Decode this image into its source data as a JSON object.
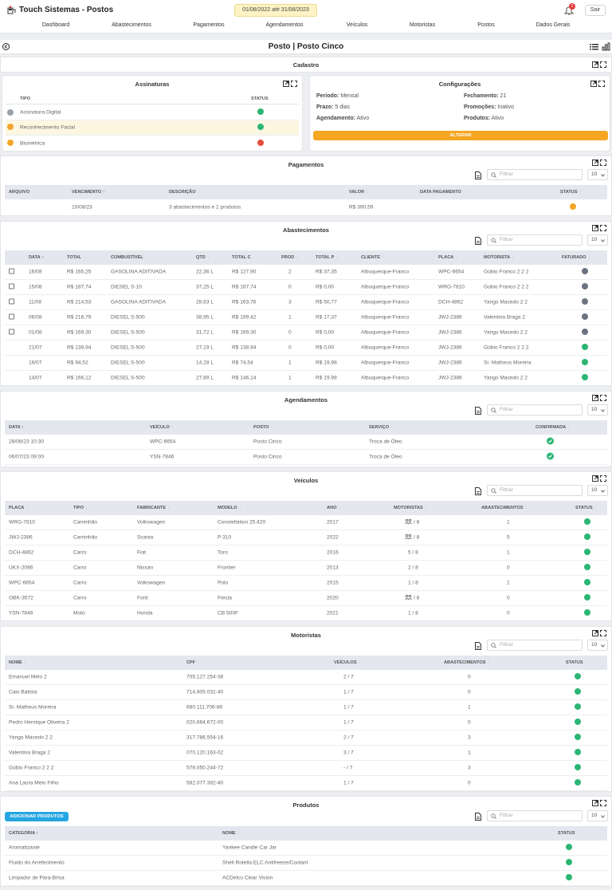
{
  "app": {
    "title": "Touch Sistemas - Postos",
    "date_range": "01/08/2022 até 31/08/2023",
    "notifications": "2",
    "logout": "Sair"
  },
  "nav": [
    "Dashboard",
    "Abastecimentos",
    "Pagamentos",
    "Agendamentos",
    "Veículos",
    "Motoristas",
    "Postos",
    "Dados Gerais"
  ],
  "page": {
    "title": "Posto | Posto Cinco"
  },
  "cadastro": {
    "title": "Cadastro"
  },
  "assinaturas": {
    "title": "Assinaturas",
    "cols": [
      "TIPO",
      "STATUS"
    ],
    "rows": [
      {
        "tipo": "Assinatura Digital",
        "status": "green",
        "icon": "gray"
      },
      {
        "tipo": "Reconhecimento Facial",
        "status": "green",
        "icon": "orange"
      },
      {
        "tipo": "Biométrica",
        "status": "red",
        "icon": "orange"
      }
    ]
  },
  "configuracoes": {
    "title": "Configurações",
    "labels": {
      "periodo": "Período:",
      "prazo": "Prazo:",
      "agendamento": "Agendamento:",
      "fechamento": "Fechamento:",
      "promocoes": "Promoções:",
      "produtos": "Produtos:"
    },
    "values": {
      "periodo": "Mensal",
      "prazo": "5 dias",
      "agendamento": "Ativo",
      "fechamento": "21",
      "promocoes": "Inativo",
      "produtos": "Ativo"
    },
    "button": "ALTERAR"
  },
  "filter": {
    "placeholder": "Filtrar",
    "page_size": "10"
  },
  "pagamentos": {
    "title": "Pagamentos",
    "cols": [
      "ARQUIVO",
      "VENCIMENTO",
      "DESCRIÇÃO",
      "VALOR",
      "DATA PAGAMENTO",
      "STATUS"
    ],
    "rows": [
      {
        "arquivo": "",
        "vencimento": "10/08/23",
        "descricao": "3 abastecimentos e 2 produtos",
        "valor": "R$ 390,59",
        "data": "",
        "status": "orange"
      }
    ]
  },
  "abastecimentos": {
    "title": "Abastecimentos",
    "cols": [
      "DATA",
      "TOTAL",
      "COMBUSTÍVEL",
      "QTD",
      "TOTAL C",
      "PROD",
      "TOTAL P",
      "CLIENTE",
      "PLACA",
      "MOTORISTA",
      "FATURADO"
    ],
    "rows": [
      {
        "cb": true,
        "data": "16/08",
        "total": "R$ 165,25",
        "comb": "GASOLINA ADITIVADA",
        "qtd": "22,36 L",
        "totalc": "R$ 127,90",
        "prod": "2",
        "totalp": "R$ 37,35",
        "cliente": "Albuquerque-Franco",
        "placa": "WPC-6654",
        "motorista": "Gúbio Franco 2 2 2",
        "fat": "gray"
      },
      {
        "cb": true,
        "data": "15/08",
        "total": "R$ 187,74",
        "comb": "DIESEL S-10",
        "qtd": "37,25 L",
        "totalc": "R$ 187,74",
        "prod": "0",
        "totalp": "R$ 0,00",
        "cliente": "Albuquerque-Franco",
        "placa": "WRG-7810",
        "motorista": "Gúbio Franco 2 2 2",
        "fat": "gray"
      },
      {
        "cb": true,
        "data": "11/08",
        "total": "R$ 214,53",
        "comb": "GASOLINA ADITIVADA",
        "qtd": "28,63 L",
        "totalc": "R$ 163,76",
        "prod": "3",
        "totalp": "R$ 50,77",
        "cliente": "Albuquerque-Franco",
        "placa": "DCH-4862",
        "motorista": "Yango Macedo 2 2",
        "fat": "gray"
      },
      {
        "cb": true,
        "data": "06/08",
        "total": "R$ 216,79",
        "comb": "DIESEL S-500",
        "qtd": "38,95 L",
        "totalc": "R$ 199,42",
        "prod": "1",
        "totalp": "R$ 17,37",
        "cliente": "Albuquerque-Franco",
        "placa": "JWJ-2386",
        "motorista": "Valentina Braga 2",
        "fat": "gray"
      },
      {
        "cb": true,
        "data": "01/08",
        "total": "R$ 169,30",
        "comb": "DIESEL S-500",
        "qtd": "31,72 L",
        "totalc": "R$ 169,30",
        "prod": "0",
        "totalp": "R$ 0,00",
        "cliente": "Albuquerque-Franco",
        "placa": "JWJ-2386",
        "motorista": "Yango Macedo 2 2",
        "fat": "gray"
      },
      {
        "cb": false,
        "data": "21/07",
        "total": "R$ 138,94",
        "comb": "DIESEL S-500",
        "qtd": "27,19 L",
        "totalc": "R$ 138,94",
        "prod": "0",
        "totalp": "R$ 0,00",
        "cliente": "Albuquerque-Franco",
        "placa": "JWJ-2386",
        "motorista": "Gúbio Franco 2 2 2",
        "fat": "green"
      },
      {
        "cb": false,
        "data": "16/07",
        "total": "R$ 94,52",
        "comb": "DIESEL S-500",
        "qtd": "14,28 L",
        "totalc": "R$ 74,54",
        "prod": "1",
        "totalp": "R$ 19,98",
        "cliente": "Albuquerque-Franco",
        "placa": "JWJ-2386",
        "motorista": "Sr. Matheus Moreira",
        "fat": "green"
      },
      {
        "cb": false,
        "data": "14/07",
        "total": "R$ 166,12",
        "comb": "DIESEL S-500",
        "qtd": "27,89 L",
        "totalc": "R$ 146,14",
        "prod": "1",
        "totalp": "R$ 19,98",
        "cliente": "Albuquerque-Franco",
        "placa": "JWJ-2386",
        "motorista": "Yango Macedo 2 2",
        "fat": "green"
      }
    ]
  },
  "agendamentos": {
    "title": "Agendamentos",
    "cols": [
      "DATA",
      "VEÍCULO",
      "POSTO",
      "SERVIÇO",
      "CONFIRMADA"
    ],
    "rows": [
      {
        "data": "28/08/23 10:30",
        "veiculo": "WPC-6654",
        "posto": "Posto Cinco",
        "servico": "Troca de Óleo"
      },
      {
        "data": "06/07/23 09:00",
        "veiculo": "YSN-7846",
        "posto": "Posto Cinco",
        "servico": "Troca de Óleo"
      }
    ]
  },
  "veiculos": {
    "title": "Veículos",
    "cols": [
      "PLACA",
      "TIPO",
      "FABRICANTE",
      "MODELO",
      "ANO",
      "MOTORISTAS",
      "ABASTECIMENTOS",
      "STATUS"
    ],
    "rows": [
      {
        "placa": "WRG-7810",
        "tipo": "Caminhão",
        "fab": "Volkswagen",
        "modelo": "Constellation 25.420",
        "ano": "2017",
        "mot": "/ 8",
        "all": true,
        "abast": "1"
      },
      {
        "placa": "JWJ-2386",
        "tipo": "Caminhão",
        "fab": "Scania",
        "modelo": "P 310",
        "ano": "2022",
        "mot": "/ 8",
        "all": true,
        "abast": "5"
      },
      {
        "placa": "DCH-4862",
        "tipo": "Carro",
        "fab": "Fiat",
        "modelo": "Toro",
        "ano": "2016",
        "mot": "5 / 8",
        "all": false,
        "abast": "1"
      },
      {
        "placa": "UKX-2086",
        "tipo": "Carro",
        "fab": "Nissan",
        "modelo": "Frontier",
        "ano": "2013",
        "mot": "2 / 8",
        "all": false,
        "abast": "0"
      },
      {
        "placa": "WPC-6654",
        "tipo": "Carro",
        "fab": "Volkswagen",
        "modelo": "Polo",
        "ano": "2015",
        "mot": "1 / 8",
        "all": false,
        "abast": "1"
      },
      {
        "placa": "OBK-3572",
        "tipo": "Carro",
        "fab": "Ford",
        "modelo": "Fiesta",
        "ano": "2020",
        "mot": "/ 8",
        "all": true,
        "abast": "0"
      },
      {
        "placa": "YSN-7846",
        "tipo": "Moto",
        "fab": "Honda",
        "modelo": "CB 500F",
        "ano": "2021",
        "mot": "1 / 8",
        "all": false,
        "abast": "0"
      }
    ]
  },
  "motoristas": {
    "title": "Motoristas",
    "cols": [
      "NOME",
      "CPF",
      "VEÍCULOS",
      "ABASTECIMENTOS",
      "STATUS"
    ],
    "rows": [
      {
        "nome": "Emanuel Melo 2",
        "cpf": "705.127.254-38",
        "veic": "2 / 7",
        "abast": "0"
      },
      {
        "nome": "Caio Batista",
        "cpf": "714.805.032-40",
        "veic": "1 / 7",
        "abast": "0"
      },
      {
        "nome": "Sr. Matheus Moreira",
        "cpf": "680.111.706-86",
        "veic": "1 / 7",
        "abast": "1"
      },
      {
        "nome": "Pedro Henrique Oliveira 2",
        "cpf": "020.664.672-00",
        "veic": "1 / 7",
        "abast": "0"
      },
      {
        "nome": "Yango Macedo 2 2",
        "cpf": "317.786.554-16",
        "veic": "2 / 7",
        "abast": "3"
      },
      {
        "nome": "Valentina Braga 2",
        "cpf": "070.120.163-02",
        "veic": "3 / 7",
        "abast": "1"
      },
      {
        "nome": "Gúbio Franco 2 2 2",
        "cpf": "578.050.244-72",
        "veic": "- / 7",
        "abast": "3"
      },
      {
        "nome": "Ana Laura Melo Filho",
        "cpf": "582.077.382-40",
        "veic": "1 / 7",
        "abast": "0"
      }
    ]
  },
  "produtos": {
    "title": "Produtos",
    "add_button": "ADICIONAR PRODUTOS",
    "cols": [
      "CATEGORIA",
      "NOME",
      "STATUS"
    ],
    "rows": [
      {
        "cat": "Aromatizante",
        "nome": "Yankee Candle Car Jar"
      },
      {
        "cat": "Fluido do Arrefecimento",
        "nome": "Shell Rotella ELC Antifreeze/Coolant"
      },
      {
        "cat": "Limpador de Para-Brisa",
        "nome": "ACDelco Clear Vision"
      }
    ]
  },
  "colors": {
    "green": "#2bb673",
    "red": "#e74c3c",
    "orange": "#f2a629",
    "gray": "#6c7481",
    "accent": "#f5a623",
    "blue": "#26a6e0"
  }
}
